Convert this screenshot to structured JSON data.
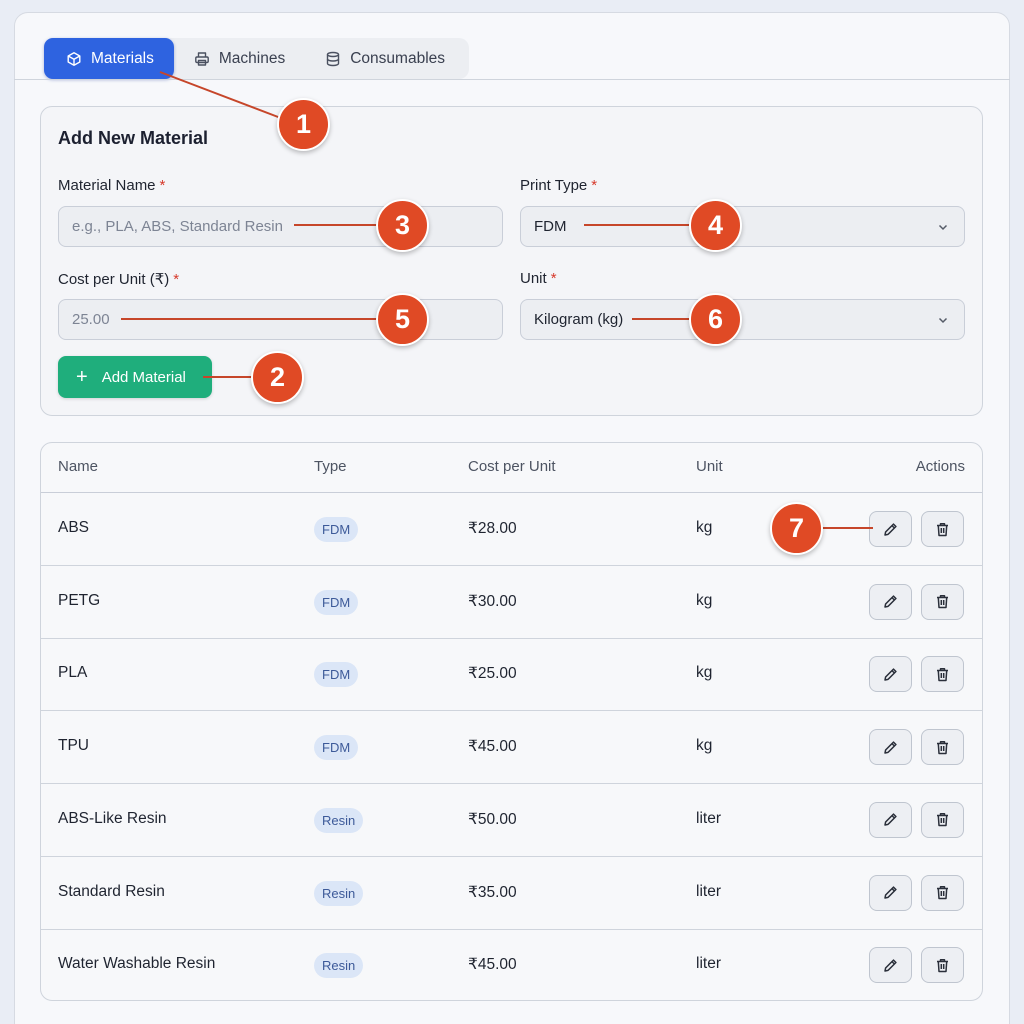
{
  "tabs": [
    {
      "label": "Materials",
      "icon": "cube-icon",
      "active": true
    },
    {
      "label": "Machines",
      "icon": "printer-icon",
      "active": false
    },
    {
      "label": "Consumables",
      "icon": "database-icon",
      "active": false
    }
  ],
  "form": {
    "title": "Add New Material",
    "material_name_label": "Material Name",
    "material_name_placeholder": "e.g., PLA, ABS, Standard Resin",
    "print_type_label": "Print Type",
    "print_type_value": "FDM",
    "cost_label": "Cost per Unit (₹)",
    "cost_placeholder": "25.00",
    "unit_label": "Unit",
    "unit_value": "Kilogram (kg)",
    "required_mark": "*",
    "add_button": "Add Material"
  },
  "table": {
    "headers": {
      "name": "Name",
      "type": "Type",
      "cost": "Cost per Unit",
      "unit": "Unit",
      "actions": "Actions"
    },
    "rows": [
      {
        "name": "ABS",
        "type": "FDM",
        "cost": "₹28.00",
        "unit": "kg"
      },
      {
        "name": "PETG",
        "type": "FDM",
        "cost": "₹30.00",
        "unit": "kg"
      },
      {
        "name": "PLA",
        "type": "FDM",
        "cost": "₹25.00",
        "unit": "kg"
      },
      {
        "name": "TPU",
        "type": "FDM",
        "cost": "₹45.00",
        "unit": "kg"
      },
      {
        "name": "ABS-Like Resin",
        "type": "Resin",
        "cost": "₹50.00",
        "unit": "liter"
      },
      {
        "name": "Standard Resin",
        "type": "Resin",
        "cost": "₹35.00",
        "unit": "liter"
      },
      {
        "name": "Water Washable Resin",
        "type": "Resin",
        "cost": "₹45.00",
        "unit": "liter"
      }
    ]
  },
  "callouts": [
    "1",
    "2",
    "3",
    "4",
    "5",
    "6",
    "7"
  ],
  "colors": {
    "accent": "#2e63e0",
    "success": "#1fae7c",
    "callout": "#e04a25"
  }
}
